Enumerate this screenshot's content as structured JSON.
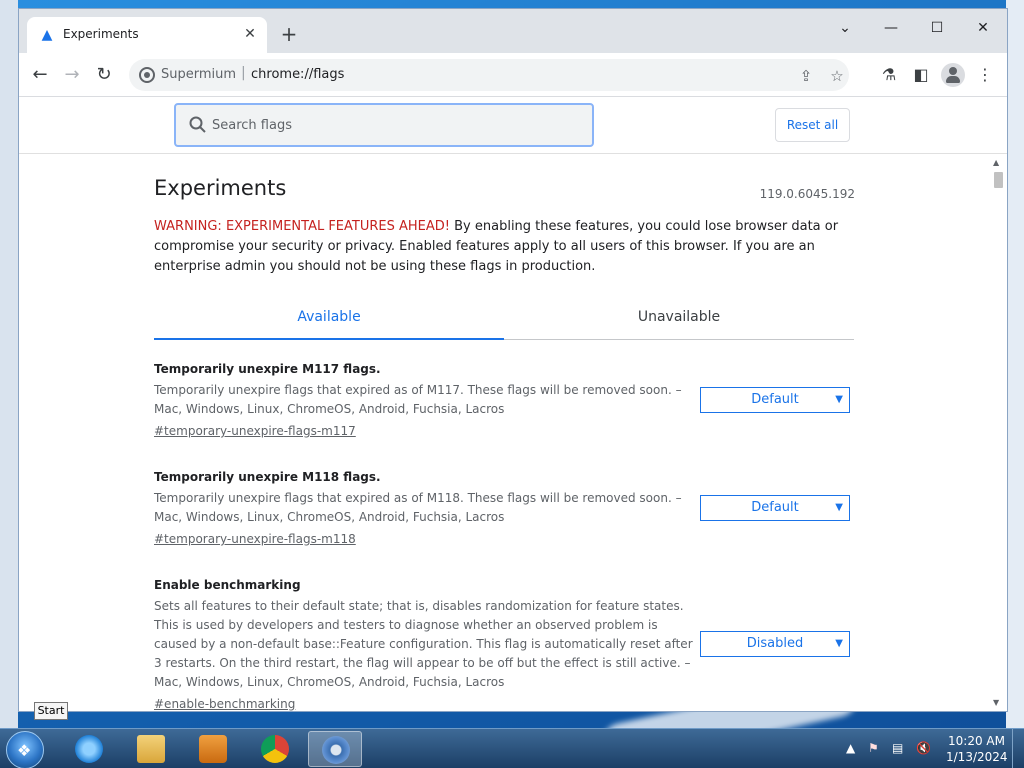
{
  "window": {
    "tab_title": "Experiments",
    "tab_close": "✕",
    "new_tab": "+",
    "controls": {
      "collapse": "⌄",
      "minimize": "—",
      "maximize": "☐",
      "close": "✕"
    }
  },
  "toolbar": {
    "back": "←",
    "forward": "→",
    "reload": "↻",
    "site_name": "Supermium",
    "separator": "|",
    "url": "chrome://flags"
  },
  "flags_header": {
    "search_placeholder": "Search flags",
    "reset_label": "Reset all"
  },
  "page": {
    "title": "Experiments",
    "version": "119.0.6045.192",
    "warning_strong": "WARNING: EXPERIMENTAL FEATURES AHEAD!",
    "warning_text": " By enabling these features, you could lose browser data or compromise your security or privacy. Enabled features apply to all users of this browser. If you are an enterprise admin you should not be using these flags in production.",
    "tabs": {
      "available": "Available",
      "unavailable": "Unavailable"
    }
  },
  "flags": [
    {
      "title": "Temporarily unexpire M117 flags.",
      "description": "Temporarily unexpire flags that expired as of M117. These flags will be removed soon. – Mac, Windows, Linux, ChromeOS, Android, Fuchsia, Lacros",
      "link": "#temporary-unexpire-flags-m117",
      "value": "Default"
    },
    {
      "title": "Temporarily unexpire M118 flags.",
      "description": "Temporarily unexpire flags that expired as of M118. These flags will be removed soon. – Mac, Windows, Linux, ChromeOS, Android, Fuchsia, Lacros",
      "link": "#temporary-unexpire-flags-m118",
      "value": "Default"
    },
    {
      "title": "Enable benchmarking",
      "description": "Sets all features to their default state; that is, disables randomization for feature states. This is used by developers and testers to diagnose whether an observed problem is caused by a non-default base::Feature configuration. This flag is automatically reset after 3 restarts. On the third restart, the flag will appear to be off but the effect is still active. – Mac, Windows, Linux, ChromeOS, Android, Fuchsia, Lacros",
      "link": "#enable-benchmarking",
      "value": "Disabled"
    }
  ],
  "taskbar": {
    "start_tooltip": "Start",
    "clock_time": "10:20 AM",
    "clock_date": "1/13/2024",
    "tray_arrow": "▲"
  },
  "colors": {
    "accent": "#1a73e8",
    "warning": "#c5221f",
    "taskbar": "#2a5580"
  }
}
